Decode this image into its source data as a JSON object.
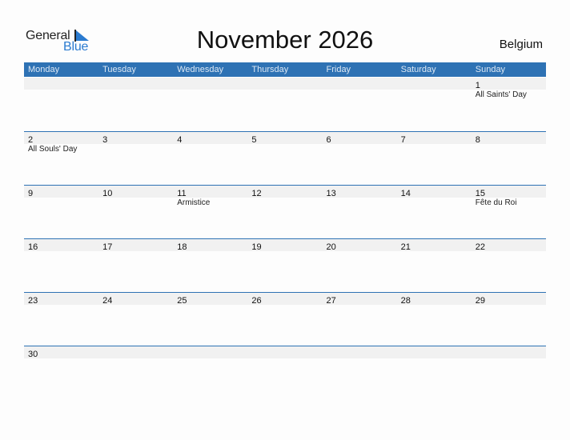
{
  "logo": {
    "line1": "General",
    "line2": "Blue",
    "accent_color": "#2b7bd0"
  },
  "title": "November 2026",
  "country": "Belgium",
  "colors": {
    "header_bg": "#2e72b4",
    "strip_bg": "#f1f1f1"
  },
  "weekdays": [
    "Monday",
    "Tuesday",
    "Wednesday",
    "Thursday",
    "Friday",
    "Saturday",
    "Sunday"
  ],
  "weeks": [
    {
      "days": [
        {
          "num": "",
          "holiday": ""
        },
        {
          "num": "",
          "holiday": ""
        },
        {
          "num": "",
          "holiday": ""
        },
        {
          "num": "",
          "holiday": ""
        },
        {
          "num": "",
          "holiday": ""
        },
        {
          "num": "",
          "holiday": ""
        },
        {
          "num": "1",
          "holiday": "All Saints' Day"
        }
      ]
    },
    {
      "days": [
        {
          "num": "2",
          "holiday": "All Souls' Day"
        },
        {
          "num": "3",
          "holiday": ""
        },
        {
          "num": "4",
          "holiday": ""
        },
        {
          "num": "5",
          "holiday": ""
        },
        {
          "num": "6",
          "holiday": ""
        },
        {
          "num": "7",
          "holiday": ""
        },
        {
          "num": "8",
          "holiday": ""
        }
      ]
    },
    {
      "days": [
        {
          "num": "9",
          "holiday": ""
        },
        {
          "num": "10",
          "holiday": ""
        },
        {
          "num": "11",
          "holiday": "Armistice"
        },
        {
          "num": "12",
          "holiday": ""
        },
        {
          "num": "13",
          "holiday": ""
        },
        {
          "num": "14",
          "holiday": ""
        },
        {
          "num": "15",
          "holiday": "Fête du Roi"
        }
      ]
    },
    {
      "days": [
        {
          "num": "16",
          "holiday": ""
        },
        {
          "num": "17",
          "holiday": ""
        },
        {
          "num": "18",
          "holiday": ""
        },
        {
          "num": "19",
          "holiday": ""
        },
        {
          "num": "20",
          "holiday": ""
        },
        {
          "num": "21",
          "holiday": ""
        },
        {
          "num": "22",
          "holiday": ""
        }
      ]
    },
    {
      "days": [
        {
          "num": "23",
          "holiday": ""
        },
        {
          "num": "24",
          "holiday": ""
        },
        {
          "num": "25",
          "holiday": ""
        },
        {
          "num": "26",
          "holiday": ""
        },
        {
          "num": "27",
          "holiday": ""
        },
        {
          "num": "28",
          "holiday": ""
        },
        {
          "num": "29",
          "holiday": ""
        }
      ]
    },
    {
      "days": [
        {
          "num": "30",
          "holiday": ""
        },
        {
          "num": "",
          "holiday": ""
        },
        {
          "num": "",
          "holiday": ""
        },
        {
          "num": "",
          "holiday": ""
        },
        {
          "num": "",
          "holiday": ""
        },
        {
          "num": "",
          "holiday": ""
        },
        {
          "num": "",
          "holiday": ""
        }
      ]
    }
  ]
}
